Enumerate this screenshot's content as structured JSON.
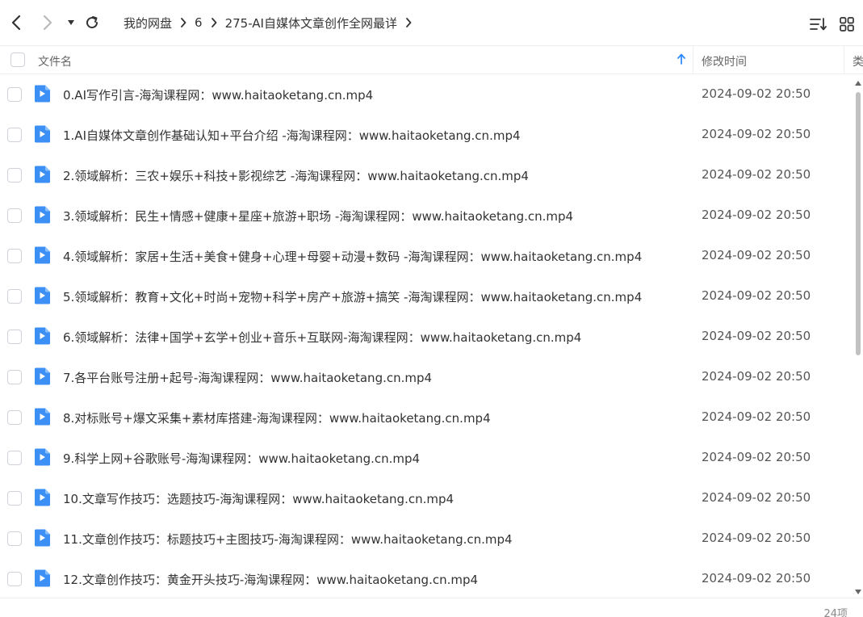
{
  "toolbar": {
    "breadcrumb": [
      "我的网盘",
      "6",
      "275-AI自媒体文章创作全网最详"
    ],
    "icons": {
      "back": "chevron-left-icon",
      "forward": "chevron-right-icon",
      "history": "caret-down-icon",
      "refresh": "refresh-icon",
      "sort": "sort-list-icon",
      "grid": "grid-view-icon"
    }
  },
  "header": {
    "name": "文件名",
    "time": "修改时间",
    "type": "类",
    "sort_icon": "arrow-up-icon"
  },
  "files": [
    {
      "name": "0.AI写作引言-海淘课程网：www.haitaoketang.cn.mp4",
      "time": "2024-09-02 20:50"
    },
    {
      "name": "1.AI自媒体文章创作基础认知+平台介绍 -海淘课程网：www.haitaoketang.cn.mp4",
      "time": "2024-09-02 20:50"
    },
    {
      "name": "2.领域解析：三农+娱乐+科技+影视综艺 -海淘课程网：www.haitaoketang.cn.mp4",
      "time": "2024-09-02 20:50"
    },
    {
      "name": "3.领域解析：民生+情感+健康+星座+旅游+职场 -海淘课程网：www.haitaoketang.cn.mp4",
      "time": "2024-09-02 20:50"
    },
    {
      "name": "4.领域解析：家居+生活+美食+健身+心理+母婴+动漫+数码 -海淘课程网：www.haitaoketang.cn.mp4",
      "time": "2024-09-02 20:50"
    },
    {
      "name": "5.领域解析：教育+文化+时尚+宠物+科学+房产+旅游+搞笑 -海淘课程网：www.haitaoketang.cn.mp4",
      "time": "2024-09-02 20:50"
    },
    {
      "name": "6.领域解析：法律+国学+玄学+创业+音乐+互联网-海淘课程网：www.haitaoketang.cn.mp4",
      "time": "2024-09-02 20:50"
    },
    {
      "name": "7.各平台账号注册+起号-海淘课程网：www.haitaoketang.cn.mp4",
      "time": "2024-09-02 20:50"
    },
    {
      "name": "8.对标账号+爆文采集+素材库搭建-海淘课程网：www.haitaoketang.cn.mp4",
      "time": "2024-09-02 20:50"
    },
    {
      "name": "9.科学上网+谷歌账号-海淘课程网：www.haitaoketang.cn.mp4",
      "time": "2024-09-02 20:50"
    },
    {
      "name": "10.文章写作技巧：选题技巧-海淘课程网：www.haitaoketang.cn.mp4",
      "time": "2024-09-02 20:50"
    },
    {
      "name": "11.文章创作技巧：标题技巧+主图技巧-海淘课程网：www.haitaoketang.cn.mp4",
      "time": "2024-09-02 20:50"
    },
    {
      "name": "12.文章创作技巧：黄金开头技巧-海淘课程网：www.haitaoketang.cn.mp4",
      "time": "2024-09-02 20:50"
    }
  ],
  "footer": {
    "count": "24项"
  },
  "colors": {
    "accent": "#2f8cff",
    "file_icon": "#3b8ff5"
  }
}
